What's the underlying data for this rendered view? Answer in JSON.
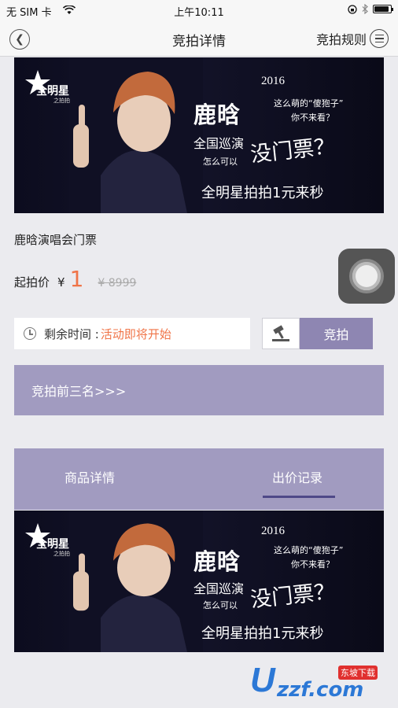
{
  "status_bar": {
    "carrier": "无 SIM 卡",
    "time": "上午10:11",
    "battery_level": 0.9
  },
  "nav": {
    "title": "竞拍详情",
    "rules": "竞拍规则"
  },
  "banner": {
    "logo": "全明星",
    "logo_sub": "之拍拍",
    "year": "2016",
    "name": "鹿晗",
    "question_1": "这么萌的“傻狍子”",
    "question_2": "你不来看？",
    "tour": "全国巡演",
    "how": "怎么可以",
    "no_ticket": "没门票？",
    "slogan": "全明星拍拍1元来秒"
  },
  "product": {
    "name": "鹿晗演唱会门票",
    "start_label": "起拍价",
    "currency": "¥",
    "start_price": "1",
    "original_price": "¥ 8999"
  },
  "auction": {
    "time_label": "剩余时间 : ",
    "status": "活动即将开始",
    "bid_label": "竞拍"
  },
  "top_three": "竞拍前三名>>>",
  "tabs": [
    {
      "label": "商品详情"
    },
    {
      "label": "出价记录"
    }
  ],
  "watermark": {
    "letter": "U",
    "rest": "zzf.com",
    "tag": "东坡下载"
  }
}
